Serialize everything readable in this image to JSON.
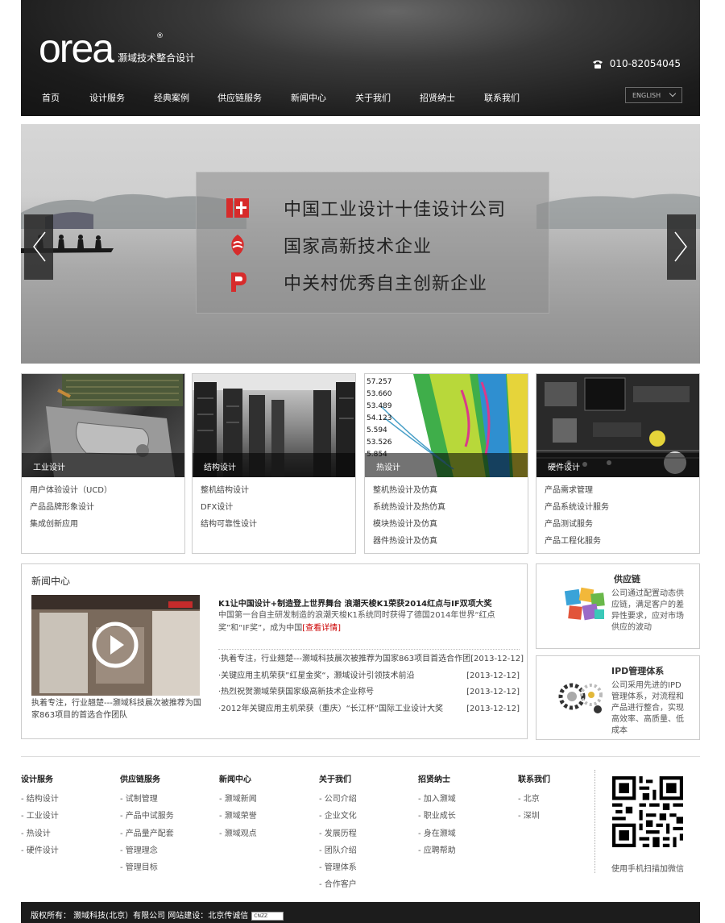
{
  "header": {
    "logo_text": "orea",
    "logo_reg": "®",
    "tagline": "灏域技术整合设计",
    "phone": "010-82054045",
    "nav": [
      "首页",
      "设计服务",
      "经典案例",
      "供应链服务",
      "新闻中心",
      "关于我们",
      "招贤纳士",
      "联系我们"
    ],
    "lang": "ENGLISH"
  },
  "banner": {
    "lines": [
      "中国工业设计十佳设计公司",
      "国家高新技术企业",
      "中关村优秀自主创新企业"
    ],
    "accent": "#d72b2b"
  },
  "services": [
    {
      "caption": "工业设计",
      "items": [
        "用户体验设计（UCD）",
        "产品品牌形象设计",
        "集成创新应用"
      ]
    },
    {
      "caption": "结构设计",
      "items": [
        "整机结构设计",
        "DFX设计",
        "结构可靠性设计"
      ]
    },
    {
      "caption": "热设计",
      "items": [
        "整机热设计及仿真",
        "系统热设计及热仿真",
        "模块热设计及仿真",
        "器件热设计及仿真"
      ]
    },
    {
      "caption": "硬件设计",
      "items": [
        "产品需求管理",
        "产品系统设计服务",
        "产品测试服务",
        "产品工程化服务"
      ]
    }
  ],
  "heat_numbers": [
    "57.257",
    "53.660",
    "53.489",
    "54.123",
    "5.594",
    "53.526",
    "5.854"
  ],
  "news": {
    "title": "新闻中心",
    "video_caption": "执着专注，行业翘楚---灏域科技晨次被推荐为国家863项目的首选合作团队",
    "feature_title": "K1让中国设计+制造登上世界舞台 浪潮天梭K1荣获2014红点与IF双项大奖",
    "feature_text": "中国第一台自主研发制造的浪潮天梭K1系统同时获得了德国2014年世界“红点奖”和“IF奖”，成为中国",
    "feature_more": "[查看详情]",
    "list": [
      {
        "text": "·执着专注，行业翘楚---灏域科技晨次被推荐为国家863项目首选合作团",
        "date": "[2013-12-12]"
      },
      {
        "text": "·关键应用主机荣获”红星金奖“，灏域设计引领技术前沿",
        "date": "[2013-12-12]"
      },
      {
        "text": "·热烈祝贺灏域荣获国家级高新技术企业称号",
        "date": "[2013-12-12]"
      },
      {
        "text": "·2012年关键应用主机荣获（重庆）“长江杯”国际工业设计大奖",
        "date": "[2013-12-12]"
      }
    ]
  },
  "side": {
    "supply": {
      "title": "供应链",
      "text": "公司通过配置动态供应链，满足客户的差异性要求，应对市场供应的波动"
    },
    "ipd": {
      "title": "IPD管理体系",
      "text": "公司采用先进的IPD管理体系，对流程和产品进行整合，实现高效率、高质量、低成本"
    }
  },
  "footer": {
    "columns": [
      {
        "head": "设计服务",
        "items": [
          "- 结构设计",
          "- 工业设计",
          "- 热设计",
          "- 硬件设计"
        ]
      },
      {
        "head": "供应链服务",
        "items": [
          "- 试制管理",
          "- 产品中试服务",
          "- 产品量产配套",
          "- 管理理念",
          "- 管理目标"
        ]
      },
      {
        "head": "新闻中心",
        "items": [
          "- 灏域新闻",
          "- 灏域荣誉",
          "- 灏域观点"
        ]
      },
      {
        "head": "关于我们",
        "items": [
          "- 公司介绍",
          "- 企业文化",
          "- 发展历程",
          "- 团队介绍",
          "- 管理体系",
          "- 合作客户"
        ]
      },
      {
        "head": "招贤纳士",
        "items": [
          "- 加入灏域",
          "- 职业成长",
          "- 身在灏域",
          "- 应聘帮助"
        ]
      },
      {
        "head": "联系我们",
        "items": [
          "- 北京",
          "- 深圳"
        ]
      }
    ],
    "qr_caption": "使用手机扫描加微信",
    "copyright": "版权所有：  灏域科技(北京）有限公司 网站建设：北京传诚信",
    "cnzz": "CNZZ"
  }
}
